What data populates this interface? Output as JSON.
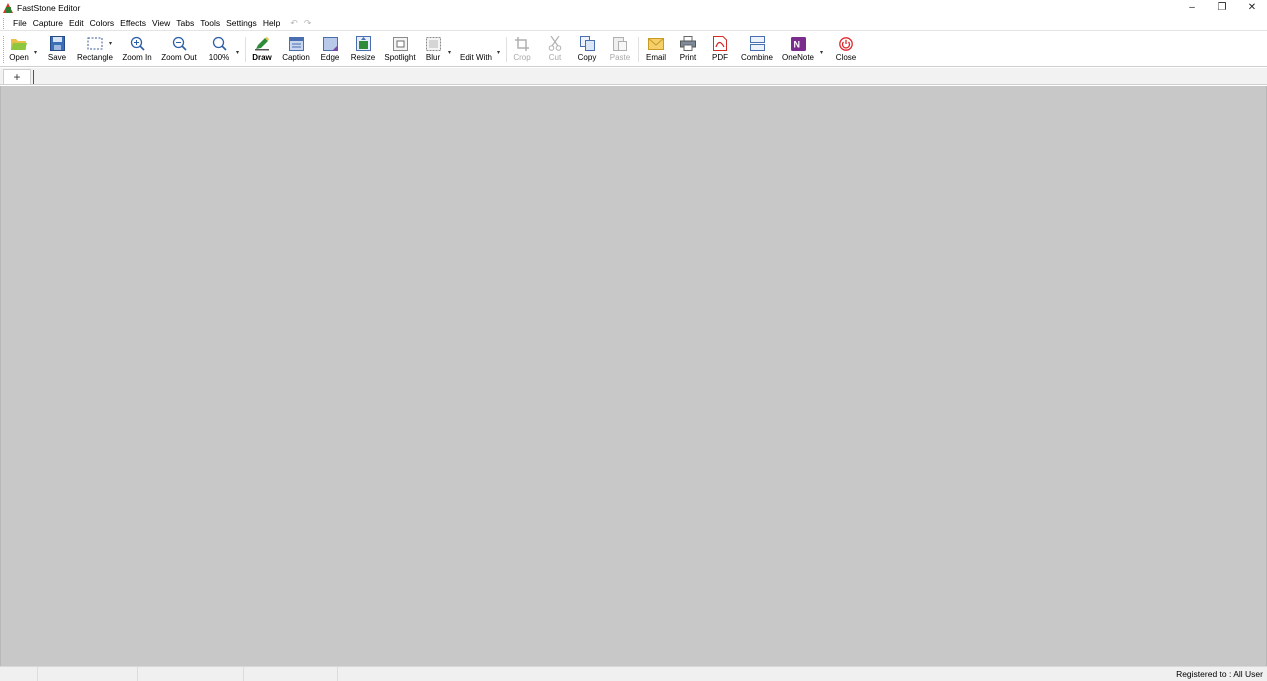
{
  "window": {
    "title": "FastStone Editor",
    "controls": {
      "minimize": "–",
      "restore": "❐",
      "close": "✕"
    }
  },
  "menu": {
    "items": [
      "File",
      "Capture",
      "Edit",
      "Colors",
      "Effects",
      "View",
      "Tabs",
      "Tools",
      "Settings",
      "Help"
    ],
    "undo": "↶",
    "redo": "↷"
  },
  "toolbar": {
    "open": "Open",
    "save": "Save",
    "rectangle": "Rectangle",
    "zoom_in": "Zoom In",
    "zoom_out": "Zoom Out",
    "zoom_level": "100%",
    "draw": "Draw",
    "caption": "Caption",
    "edge": "Edge",
    "resize": "Resize",
    "spotlight": "Spotlight",
    "blur": "Blur",
    "edit_with": "Edit With",
    "crop": "Crop",
    "cut": "Cut",
    "copy": "Copy",
    "paste": "Paste",
    "email": "Email",
    "print": "Print",
    "pdf": "PDF",
    "combine": "Combine",
    "onenote": "OneNote",
    "close": "Close"
  },
  "tabs": {
    "add": "+"
  },
  "status": {
    "registration": "Registered to : All User"
  },
  "colors": {
    "canvas": "#c8c8c8",
    "open_icon": "#8dc63f",
    "save_icon": "#3b6fb6",
    "draw_icon": "#2e8b3a",
    "onenote_icon": "#7b2d8e",
    "close_icon": "#e0282e",
    "pdf_icon": "#d42a2a",
    "email_icon": "#e9b53a"
  }
}
